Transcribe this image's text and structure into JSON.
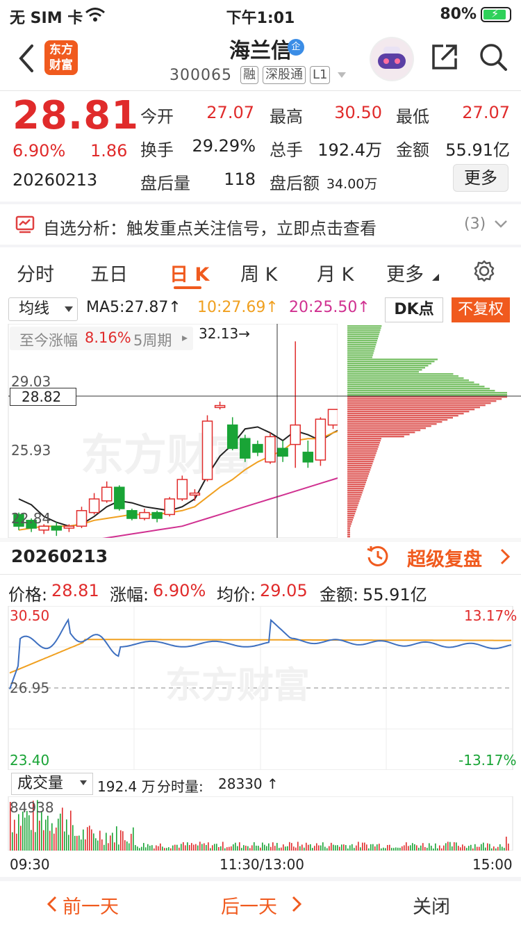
{
  "status_bar": {
    "carrier": "无 SIM 卡",
    "time": "下午1:01",
    "battery": "80%"
  },
  "header": {
    "name": "海兰信",
    "badge": "企",
    "code": "300065",
    "tags": [
      "融",
      "深股通",
      "L1"
    ],
    "logo_text": [
      "东方",
      "财富"
    ]
  },
  "quote": {
    "price": "28.81",
    "change_pct": "6.90%",
    "change_amt": "1.86",
    "date": "20260213",
    "open_label": "今开",
    "open": "27.07",
    "high_label": "最高",
    "high": "30.50",
    "low_label": "最低",
    "low": "27.07",
    "turnover_label": "换手",
    "turnover": "29.29%",
    "volume_label": "总手",
    "volume": "192.4万",
    "amount_label": "金额",
    "amount": "55.91亿",
    "after_vol_label": "盘后量",
    "after_vol": "118",
    "after_amt_label": "盘后额",
    "after_amt": "34.00万",
    "more": "更多"
  },
  "signal": {
    "text": "自选分析：触发重点关注信号，立即点击查看",
    "count": "(3)"
  },
  "tabs": [
    "分时",
    "五日",
    "日 K",
    "周 K",
    "月 K",
    "更多"
  ],
  "active_tab": 2,
  "kline_toolbar": {
    "indicator": "均线",
    "ma5": "MA5:27.87↑",
    "ma10": "10:27.69↑",
    "ma20": "20:25.50↑",
    "dk": "DK点",
    "fq": "不复权",
    "ma10_color": "#f0a020",
    "ma20_color": "#d03090"
  },
  "kline": {
    "max_label": "32.13→",
    "period_label": "至今涨幅",
    "period_value": "8.16%",
    "period_unit": "5周期",
    "y_labels": [
      "29.03",
      "28.82",
      "25.93",
      "22.84"
    ],
    "top_label_partial": "32"
  },
  "kline_footer": {
    "date": "20260213",
    "replay": "超级复盘"
  },
  "timeshare": {
    "price_label": "价格:",
    "price": "28.81",
    "chg_label": "涨幅:",
    "chg": "6.90%",
    "avg_label": "均价:",
    "avg": "29.05",
    "amt_label": "金额:",
    "amt": "55.91亿",
    "y_high": "30.50",
    "y_mid": "26.95",
    "y_low": "23.40",
    "pct_high": "13.17%",
    "pct_low": "-13.17%"
  },
  "volume_panel": {
    "indicator": "成交量",
    "total": "192.4 万",
    "minute_label": "分时量:",
    "minute": "28330 ↑",
    "max": "84938",
    "x_labels": [
      "09:30",
      "11:30/13:00",
      "15:00"
    ]
  },
  "watermark": "东方财富",
  "bottom_bar": {
    "prev": "前一天",
    "next": "后一天",
    "close": "关闭"
  },
  "colors": {
    "up": "#e02b2b",
    "down": "#19a436",
    "accent": "#f05a1e",
    "price_line": "#3d6fc0",
    "avg_line": "#f0a020"
  }
}
